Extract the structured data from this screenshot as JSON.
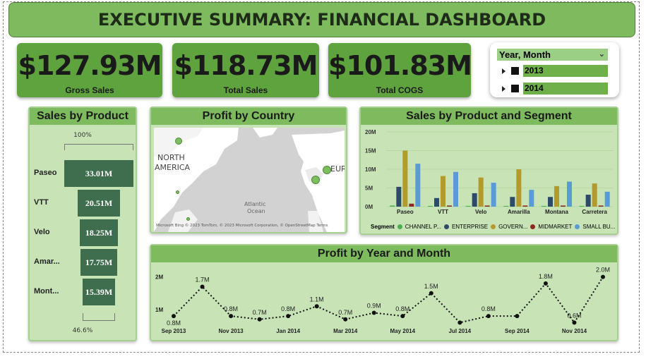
{
  "header": {
    "title": "EXECUTIVE SUMMARY: FINANCIAL DASHBOARD"
  },
  "kpis": [
    {
      "value": "$127.93M",
      "label": "Gross Sales"
    },
    {
      "value": "$118.73M",
      "label": "Total Sales"
    },
    {
      "value": "$101.83M",
      "label": "Total COGS"
    }
  ],
  "slicer": {
    "title": "Year, Month",
    "items": [
      "2013",
      "2014"
    ]
  },
  "funnel": {
    "title": "Sales by Product",
    "top_label": "100%",
    "bottom_label": "46.6%",
    "rows": [
      {
        "cat": "Paseo",
        "label": "33.01M",
        "value": 33.01
      },
      {
        "cat": "VTT",
        "label": "20.51M",
        "value": 20.51
      },
      {
        "cat": "Velo",
        "label": "18.25M",
        "value": 18.25
      },
      {
        "cat": "Amar...",
        "label": "17.75M",
        "value": 17.75
      },
      {
        "cat": "Mont...",
        "label": "15.39M",
        "value": 15.39
      }
    ]
  },
  "map": {
    "title": "Profit by Country",
    "label_na_1": "NORTH",
    "label_na_2": "AMERICA",
    "label_eu": "EUR",
    "label_ocean_1": "Atlantic",
    "label_ocean_2": "Ocean",
    "attribution": "Microsoft Bing  © 2023 TomTom, © 2023 Microsoft Corporation, © OpenStreetMap  Terms"
  },
  "chart_data": [
    {
      "type": "bar",
      "title": "Sales by Product and Segment",
      "categories": [
        "Paseo",
        "VTT",
        "Velo",
        "Amarilla",
        "Montana",
        "Carretera"
      ],
      "ylim": [
        0,
        20
      ],
      "yticks": [
        "0M",
        "5M",
        "10M",
        "15M",
        "20M"
      ],
      "legend_title": "Segment",
      "legend_labels": [
        "CHANNEL P...",
        "ENTERPRISE",
        "GOVERN...",
        "MIDMARKET",
        "SMALL BU..."
      ],
      "series": [
        {
          "name": "CHANNEL PARTNERS",
          "color": "#4caf50",
          "values": [
            0.3,
            0.2,
            0.2,
            0.2,
            0.2,
            0.2
          ]
        },
        {
          "name": "ENTERPRISE",
          "color": "#2e4a6b",
          "values": [
            5.3,
            2.3,
            3.6,
            2.6,
            2.6,
            3.2
          ]
        },
        {
          "name": "GOVERNMENT",
          "color": "#b39a2c",
          "values": [
            15.0,
            8.2,
            7.8,
            10.0,
            5.5,
            6.2
          ]
        },
        {
          "name": "MIDMARKET",
          "color": "#8b2a1f",
          "values": [
            0.8,
            0.3,
            0.3,
            0.3,
            0.3,
            0.3
          ]
        },
        {
          "name": "SMALL BUSINESS",
          "color": "#5b9bd5",
          "values": [
            11.5,
            9.3,
            6.4,
            4.5,
            6.7,
            4.0
          ]
        }
      ]
    },
    {
      "type": "line",
      "title": "Profit by Year and Month",
      "x": [
        "Sep 2013",
        "Oct 2013",
        "Nov 2013",
        "Dec 2013",
        "Jan 2014",
        "Feb 2014",
        "Mar 2014",
        "Apr 2014",
        "May 2014",
        "Jun 2014",
        "Jul 2014",
        "Aug 2014",
        "Sep 2014",
        "Oct 2014",
        "Nov 2014",
        "Dec 2014"
      ],
      "xtick_labels": [
        "Sep 2013",
        "Nov 2013",
        "Jan 2014",
        "Mar 2014",
        "May 2014",
        "Jul 2014",
        "Sep 2014",
        "Nov 2014"
      ],
      "values": [
        0.8,
        1.7,
        0.8,
        0.7,
        0.8,
        1.1,
        0.7,
        0.9,
        0.8,
        1.5,
        0.6,
        0.8,
        0.8,
        1.8,
        0.6,
        2.0
      ],
      "data_labels": [
        "0.8M",
        "1.7M",
        "0.8M",
        "0.7M",
        "0.8M",
        "1.1M",
        "0.7M",
        "0.9M",
        "0.8M",
        "1.5M",
        "",
        "0.8M",
        "",
        "1.8M",
        "0.6M",
        "2.0M"
      ],
      "yticks": [
        "1M",
        "2M"
      ],
      "ylim": [
        0.5,
        2.1
      ]
    }
  ]
}
